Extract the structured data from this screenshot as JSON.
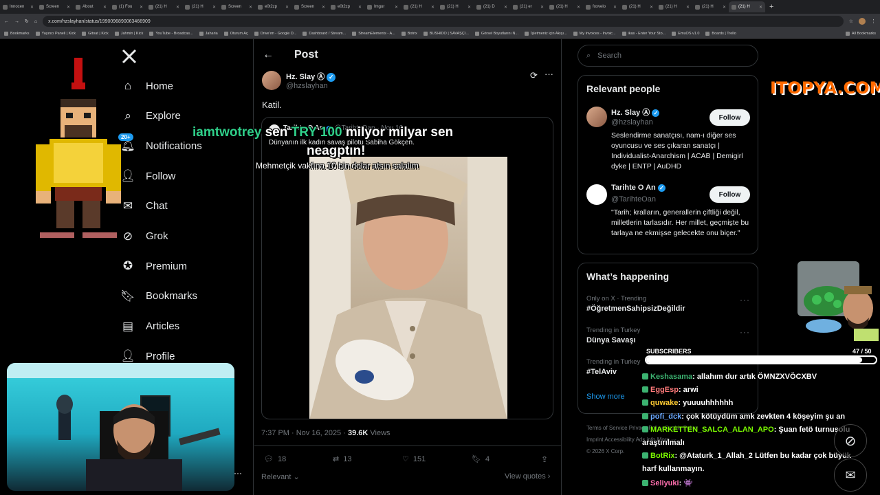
{
  "browser": {
    "tabs": [
      {
        "title": "Innocen",
        "active": false
      },
      {
        "title": "Screen",
        "active": false
      },
      {
        "title": "About",
        "active": false
      },
      {
        "title": "(1) Fou",
        "active": false
      },
      {
        "title": "(21) H",
        "active": false
      },
      {
        "title": "(21) H",
        "active": false
      },
      {
        "title": "Screen",
        "active": false
      },
      {
        "title": "e0t2zp",
        "active": false
      },
      {
        "title": "Screen",
        "active": false
      },
      {
        "title": "e0t2zp",
        "active": false
      },
      {
        "title": "Imgur",
        "active": false
      },
      {
        "title": "(21) H",
        "active": false
      },
      {
        "title": "(21) H",
        "active": false
      },
      {
        "title": "(21) D",
        "active": false
      },
      {
        "title": "(21) er",
        "active": false
      },
      {
        "title": "(21) H",
        "active": false
      },
      {
        "title": "foxvelo",
        "active": false
      },
      {
        "title": "(21) H",
        "active": false
      },
      {
        "title": "(21) H",
        "active": false
      },
      {
        "title": "(21) H",
        "active": false
      },
      {
        "title": "(21) H",
        "active": true
      }
    ],
    "new_tab": "+",
    "url": "x.com/hzslayhan/status/1990096890063466909",
    "bookmarks": [
      "Bookmarks",
      "Yayıncı Paneli | Kick",
      "Gitoat | Kick",
      "Jahmin | Kick",
      "YouTube - Broadcas...",
      "Jaharia",
      "Oturum Aç",
      "Drive'ım - Google D...",
      "Dashboard / Stream...",
      "StreamElements - A...",
      "Botrix",
      "BUSHIDO | SAVAŞÇI...",
      "Görsel Boyutlarını N...",
      "İşletmeniz için Akışı...",
      "My Invoices - Invoic...",
      "ikas - Enter Your Sto...",
      "EmuOS v1.0",
      "Boards | Trello"
    ],
    "all_bookmarks": "All Bookmarks"
  },
  "nav": {
    "logo": "X",
    "items": [
      {
        "label": "Home",
        "icon": "home-icon"
      },
      {
        "label": "Explore",
        "icon": "search-icon"
      },
      {
        "label": "Notifications",
        "icon": "bell-icon",
        "badge": "20+"
      },
      {
        "label": "Follow",
        "icon": "follow-icon"
      },
      {
        "label": "Chat",
        "icon": "mail-icon"
      },
      {
        "label": "Grok",
        "icon": "grok-icon"
      },
      {
        "label": "Premium",
        "icon": "verified-icon"
      },
      {
        "label": "Bookmarks",
        "icon": "bookmark-icon"
      },
      {
        "label": "Articles",
        "icon": "articles-icon"
      },
      {
        "label": "Profile",
        "icon": "profile-icon"
      }
    ]
  },
  "post": {
    "header_title": "Post",
    "author_name": "Hz. Slay Ⓐ",
    "author_handle": "@hzslayhan",
    "text": "Katil.",
    "quoted_author": "Tarihte O An",
    "quoted_handle": "@TarihteOan",
    "quoted_date": "Nov 16",
    "quoted_text": "Dünyanın ilk kadın savaş pilotu Sabiha Gökçen.",
    "timestamp": "7:37 PM · Nov 16, 2025 ·",
    "views": "39.6K",
    "views_label": "Views",
    "replies": "18",
    "reposts": "13",
    "likes": "151",
    "bookmarks": "4",
    "relevant_label": "Relevant",
    "view_quotes": "View quotes"
  },
  "sidebar": {
    "search_placeholder": "Search",
    "relevant_title": "Relevant people",
    "people": [
      {
        "name": "Hz. Slay Ⓐ",
        "handle": "@hzslayhan",
        "bio": "Seslendirme sanatçısı, nam-ı diğer ses oyuncusu ve ses çıkaran sanatçı | Individualist-Anarchism | ACAB | Demigirl dyke | ENTP | AuDHD",
        "follow": "Follow"
      },
      {
        "name": "Tarihte O An",
        "handle": "@TarihteOan",
        "bio": "\"Tarih; kralların, generallerin çiftliği değil, milletlerin tarlasıdır. Her millet, geçmişte bu tarlaya ne ekmişse gelecekte onu biçer.\"",
        "follow": "Follow"
      }
    ],
    "happening_title": "What’s happening",
    "trends": [
      {
        "meta": "Only on X · Trending",
        "title": "#ÖğretmenSahipsizDeğildir"
      },
      {
        "meta": "Trending in Turkey",
        "title": "Dünya Savaşı"
      },
      {
        "meta": "Trending in Turkey",
        "title": "#TelAviv"
      }
    ],
    "show_more": "Show more",
    "footer_line1": "Terms of Service   Privacy Policy   Cookie Policy",
    "footer_line2": "Imprint   Accessibility   Ads info   More ···",
    "footer_line3": "© 2026 X Corp."
  },
  "stream": {
    "brand": "ITOPYA.COM",
    "donation_name": "iamtwotrey",
    "donation_text1": "sen",
    "donation_amount": "TRY 100",
    "donation_text2": "milyor milyar sen",
    "donation_text3": "neagptın!",
    "donation_message": "Mehmetçik vakfına 10 bin dolar atsın salalım",
    "subs_label": "SUBSCRIBERS",
    "subs_count": "47 / 50",
    "subs_progress": 0.94,
    "chat": [
      {
        "user": "Keshasama",
        "color": "#3cb371",
        "msg": ": allahım dur artık ÖMNZXVÖCXBV"
      },
      {
        "user": "EggEsp",
        "color": "#ff7a7a",
        "msg": ": arwi"
      },
      {
        "user": "quwake",
        "color": "#ffcc33",
        "msg": ": yuuuuhhhhhh"
      },
      {
        "user": "pofi_dck",
        "color": "#6aa9ff",
        "msg": ": çok kötüydüm amk zevkten 4 köşeyim şu an"
      },
      {
        "user": "MARKETTEN_SALCA_ALAN_APO",
        "color": "#7cfc00",
        "msg": ": Şuan fetö turnusolu"
      },
      {
        "user": "",
        "color": "#ffffff",
        "msg": "araştırılmalı"
      },
      {
        "user": "BotRix",
        "color": "#7cfc00",
        "msg": ": @Ataturk_1_Allah_2 Lütfen bu kadar çok büyük"
      },
      {
        "user": "",
        "color": "#ffffff",
        "msg": "harf kullanmayın."
      },
      {
        "user": "Seliyuki",
        "color": "#ff6fae",
        "msg": ": 👾"
      }
    ]
  }
}
